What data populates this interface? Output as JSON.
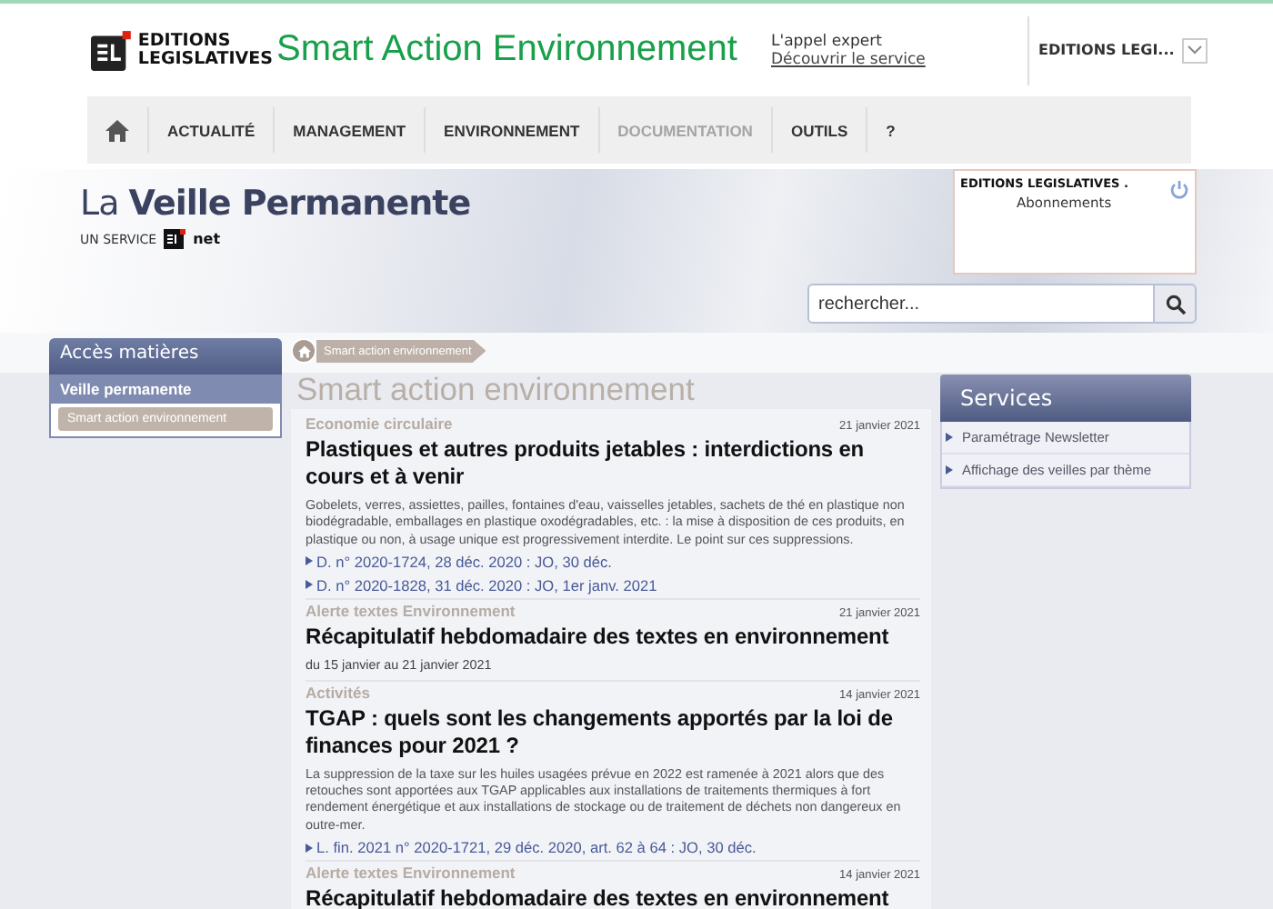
{
  "header": {
    "logo": [
      "EDITIONS",
      "LEGISLATIVES"
    ],
    "site_title": "Smart Action Environnement",
    "expert": {
      "label": "L'appel expert",
      "link": "Découvrir le service"
    },
    "account": "EDITIONS LEGI..."
  },
  "nav": [
    {
      "kind": "home",
      "disabled": false
    },
    {
      "kind": "link",
      "label": "ACTUALITÉ",
      "disabled": false
    },
    {
      "kind": "link",
      "label": "MANAGEMENT",
      "disabled": false
    },
    {
      "kind": "link",
      "label": "ENVIRONNEMENT",
      "disabled": false
    },
    {
      "kind": "link",
      "label": "DOCUMENTATION",
      "disabled": true
    },
    {
      "kind": "link",
      "label": "OUTILS",
      "disabled": false
    },
    {
      "kind": "link",
      "label": "?",
      "disabled": false
    }
  ],
  "banner": {
    "title_light": "La",
    "title_bold": "Veille Permanente",
    "service": "UN SERVICE",
    "service_brand": "net"
  },
  "user_box": {
    "name": "EDITIONS LEGISLATIVES .",
    "link": "Abonnements"
  },
  "search": {
    "placeholder": "rechercher..."
  },
  "sidebar": {
    "title": "Accès matières",
    "items": [
      {
        "label": "Veille permanente",
        "selected": false,
        "children": [
          {
            "label": "Smart action environnement",
            "selected": true
          }
        ]
      }
    ]
  },
  "breadcrumb": [
    "Smart action environnement"
  ],
  "page_title": "Smart action environnement",
  "articles": [
    {
      "category": "Economie circulaire",
      "date": "21 janvier 2021",
      "title": "Plastiques et autres produits jetables : interdictions en cours et à venir",
      "summary": "Gobelets, verres, assiettes, pailles, fontaines d'eau, vaisselles jetables, sachets de thé en plastique non biodégradable, emballages en plastique oxodégradables, etc. : la mise à disposition de ces produits, en plastique ou non, à usage unique est progressivement interdite. Le point sur ces suppressions.",
      "references": [
        "D. n° 2020-1724, 28 déc. 2020 : JO, 30 déc.",
        "D. n° 2020-1828, 31 déc. 2020 : JO, 1er janv. 2021"
      ]
    },
    {
      "category": "Alerte textes Environnement",
      "date": "21 janvier 2021",
      "title": "Récapitulatif hebdomadaire des textes en environnement",
      "subtitle": "du 15 janvier au 21 janvier 2021"
    },
    {
      "category": "Activités",
      "date": "14 janvier 2021",
      "title": "TGAP : quels sont les changements apportés par la loi de finances pour 2021 ?",
      "summary": "La suppression de la taxe sur les huiles usagées prévue en 2022 est ramenée à 2021 alors que des retouches sont apportées aux TGAP applicables aux installations de traitements thermiques à fort rendement énergétique et aux installations de stockage ou de traitement de déchets non dangereux en outre-mer.",
      "references": [
        "L. fin. 2021 n° 2020-1721, 29 déc. 2020, art. 62 à 64 : JO, 30 déc."
      ]
    },
    {
      "category": "Alerte textes Environnement",
      "date": "14 janvier 2021",
      "title": "Récapitulatif hebdomadaire des textes en environnement"
    }
  ],
  "services": {
    "title": "Services",
    "items": [
      "Paramétrage Newsletter",
      "Affichage des veilles par thème"
    ]
  }
}
